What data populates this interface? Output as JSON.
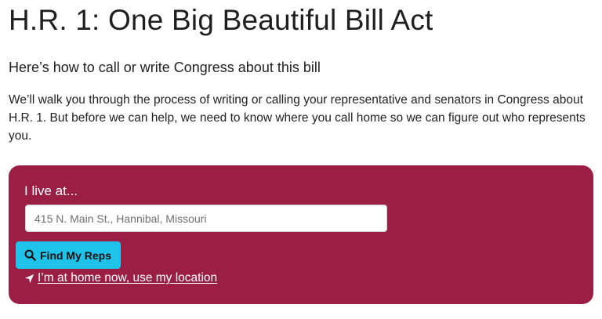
{
  "page": {
    "title": "H.R. 1: One Big Beautiful Bill Act",
    "subtitle": "Here’s how to call or write Congress about this bill",
    "intro": "We’ll walk you through the process of writing or calling your representative and senators in Congress about H.R. 1. But before we can help, we need to know where you call home so we can figure out who represents you."
  },
  "address_form": {
    "label": "I live at...",
    "input_value": "",
    "placeholder": "415 N. Main St., Hannibal, Missouri",
    "submit_label": "Find My Reps",
    "submit_icon": "search-icon",
    "location_link_label": "I’m at home now, use my location",
    "location_icon": "location-arrow-icon"
  },
  "colors": {
    "card_background": "#9b1f45",
    "button_background": "#1fc3ea",
    "text_on_card": "#ffffff"
  }
}
